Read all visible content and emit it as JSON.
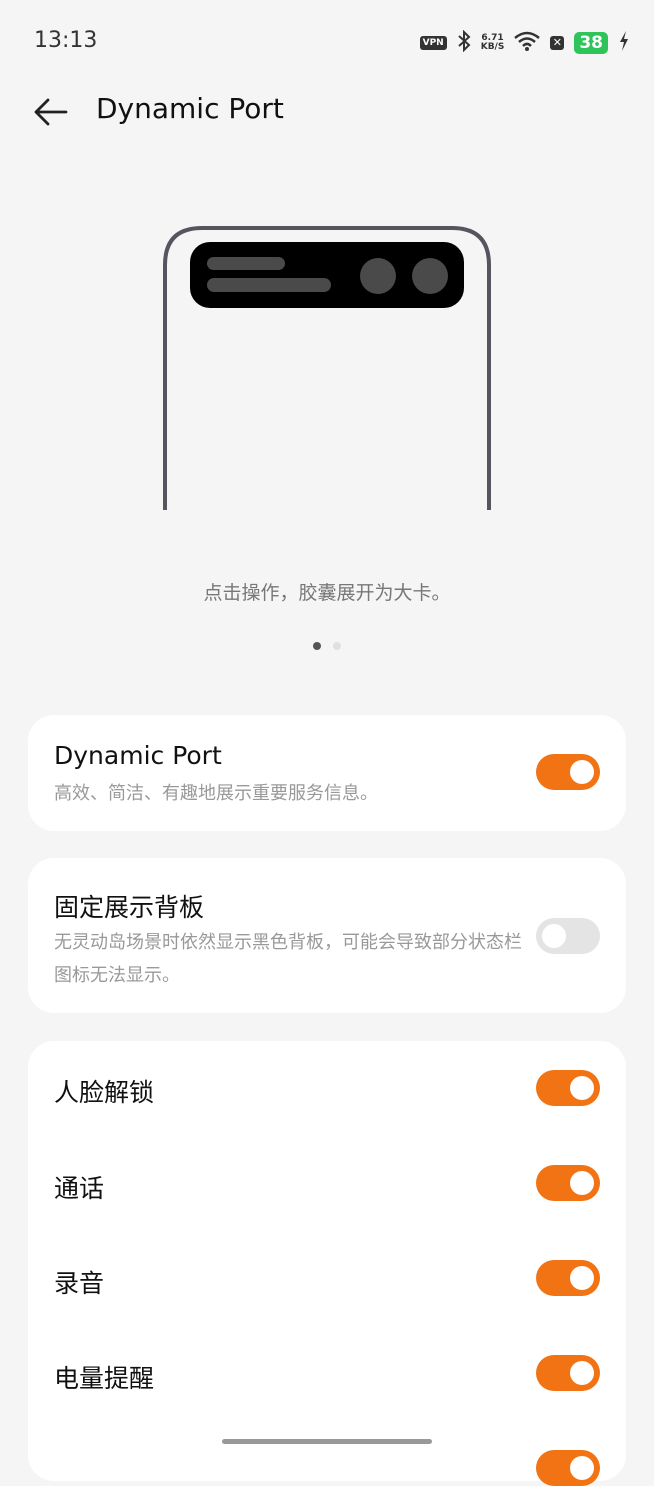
{
  "status_bar": {
    "time": "13:13",
    "vpn_label": "VPN",
    "speed_value": "6.71",
    "speed_unit": "KB/S",
    "battery_level": "38",
    "icons": [
      "vpn-icon",
      "bluetooth-icon",
      "wifi-icon",
      "no-sim-icon",
      "battery-icon",
      "charging-icon"
    ]
  },
  "header": {
    "title": "Dynamic Port"
  },
  "illustration": {
    "caption": "点击操作，胶囊展开为大卡。",
    "pager": {
      "count": 2,
      "active_index": 0
    }
  },
  "settings": {
    "dynamic_port": {
      "title": "Dynamic Port",
      "subtitle": "高效、简洁、有趣地展示重要服务信息。",
      "enabled": true
    },
    "fixed_panel": {
      "title": "固定展示背板",
      "subtitle": "无灵动岛场景时依然显示黑色背板，可能会导致部分状态栏图标无法显示。",
      "enabled": false
    },
    "apps": [
      {
        "label": "人脸解锁",
        "enabled": true
      },
      {
        "label": "通话",
        "enabled": true
      },
      {
        "label": "录音",
        "enabled": true
      },
      {
        "label": "电量提醒",
        "enabled": true
      }
    ]
  },
  "colors": {
    "accent": "#f27314",
    "toggle_off": "#e4e4e4",
    "battery": "#2ec45a"
  }
}
